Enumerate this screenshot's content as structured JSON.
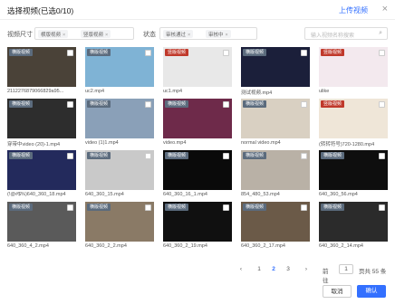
{
  "header": {
    "title": "选择视频(已选0/10)",
    "upload_label": "上传视频",
    "close_glyph": "×"
  },
  "filters": {
    "size_label": "视频尺寸",
    "size_tags": [
      "横版视频",
      "竖版视频"
    ],
    "status_label": "状态",
    "status_tags": [
      "审核通过",
      "审核中"
    ],
    "search_placeholder": "输入视频名称搜索"
  },
  "badges": {
    "horizontal": "横版视频",
    "vertical": "竖版视频"
  },
  "videos": [
    {
      "name": "2112276879066829a95...",
      "badge": "horizontal"
    },
    {
      "name": "uc2.mp4",
      "badge": "horizontal"
    },
    {
      "name": "uc1.mp4",
      "badge": "vertical"
    },
    {
      "name": "测试视频.mp4",
      "badge": "horizontal"
    },
    {
      "name": "ulike",
      "badge": "vertical"
    },
    {
      "name": "穿带中video (20)-1.mp4",
      "badge": "horizontal"
    },
    {
      "name": "video (1)1.mp4",
      "badge": "horizontal"
    },
    {
      "name": "video.mp4",
      "badge": "horizontal"
    },
    {
      "name": "normal video.mp4",
      "badge": "horizontal"
    },
    {
      "name": "(转转符号)720-1280.mp4",
      "badge": "vertical"
    },
    {
      "name": "(!@#$%)640_360_18.mp4",
      "badge": "horizontal"
    },
    {
      "name": "640_360_15.mp4",
      "badge": "horizontal"
    },
    {
      "name": "640_360_16_1.mp4",
      "badge": "horizontal"
    },
    {
      "name": "854_480_53.mp4",
      "badge": "horizontal"
    },
    {
      "name": "640_360_56.mp4",
      "badge": "horizontal"
    },
    {
      "name": "640_360_4_2.mp4",
      "badge": "horizontal"
    },
    {
      "name": "640_360_2_2.mp4",
      "badge": "horizontal"
    },
    {
      "name": "640_360_2_19.mp4",
      "badge": "horizontal"
    },
    {
      "name": "640_360_2_17.mp4",
      "badge": "horizontal"
    },
    {
      "name": "640_360_2_14.mp4",
      "badge": "horizontal"
    }
  ],
  "pagination": {
    "prev": "‹",
    "pages": [
      "1",
      "2",
      "3"
    ],
    "current": "2",
    "next": "›",
    "goto_label": "前往",
    "goto_value": "1",
    "page_suffix": "页共 55 条"
  },
  "footer": {
    "cancel_label": "取消",
    "ok_label": "确认"
  },
  "colors": {
    "accent": "#3370ff",
    "badge_horizontal": "#5b6b7d",
    "badge_vertical": "#c0392b"
  }
}
